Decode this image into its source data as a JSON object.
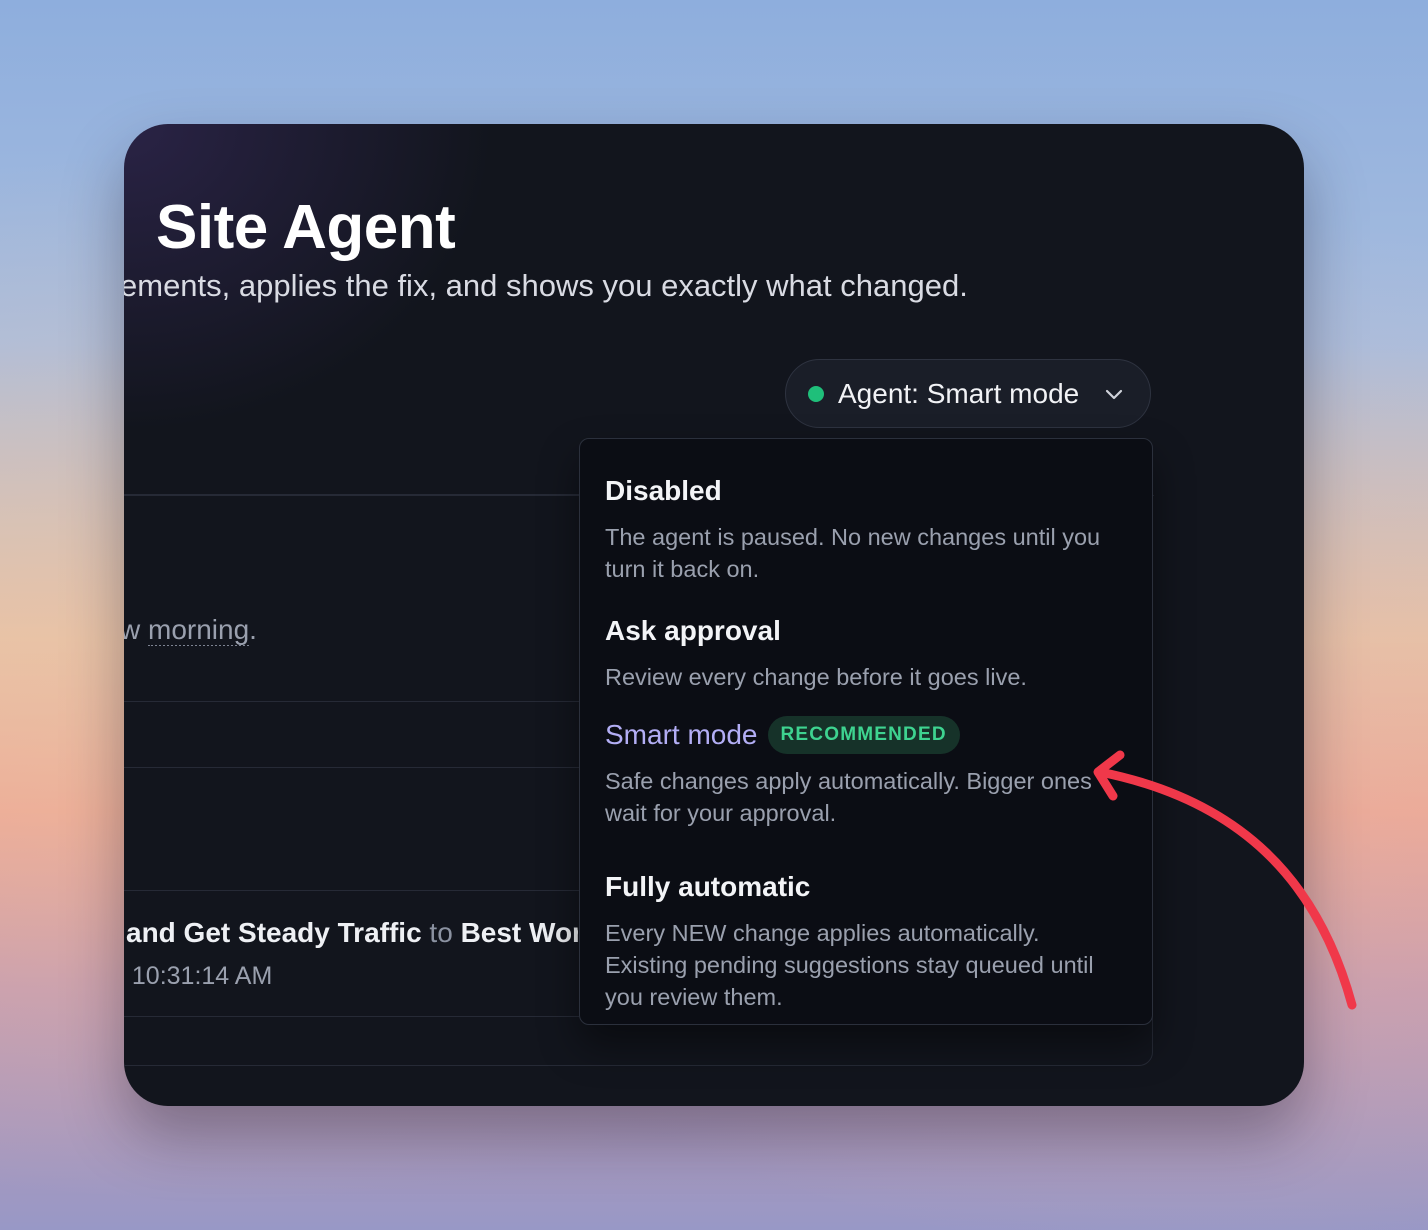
{
  "window": {
    "title": "Site Agent",
    "subtitle": "ements, applies the fix, and shows you exactly what changed."
  },
  "agent_control": {
    "label": "Agent: Smart mode",
    "status_color": "#1fbf7a",
    "icon": "chevron-down-icon"
  },
  "background_rows": {
    "row1_prefix": "w ",
    "row1_link": "morning",
    "row1_suffix": ".",
    "row2_title_part1": "and Get Steady Traffic",
    "row2_connector": "to",
    "row2_title_part2": "Best Wor",
    "row2_time": ", 10:31:14 AM"
  },
  "dropdown": {
    "options": [
      {
        "title": "Disabled",
        "description": "The agent is paused. No new changes until you turn it back on."
      },
      {
        "title": "Ask approval",
        "description": "Review every change before it goes live."
      },
      {
        "title": "Smart mode",
        "badge": "RECOMMENDED",
        "description": "Safe changes apply automatically. Bigger ones wait for your approval.",
        "selected": true
      },
      {
        "title": "Fully automatic",
        "description": "Every NEW change applies automatically. Existing pending suggestions stay queued until you review them."
      }
    ]
  },
  "annotation": {
    "arrow_color": "#f0384a"
  }
}
